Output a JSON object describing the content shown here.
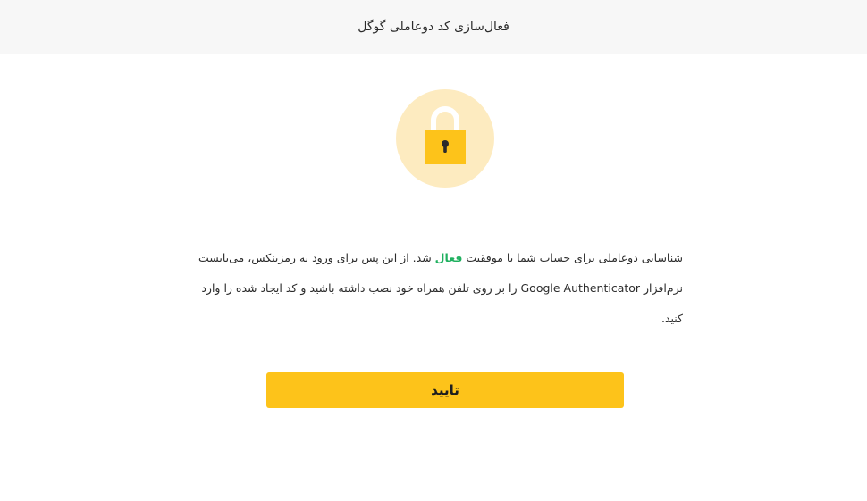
{
  "header": {
    "title": "فعال‌سازی کد دوعاملی گوگل"
  },
  "lock": {
    "icon": "padlock-icon",
    "circle_color": "#fdebc0",
    "body_color": "#fdc31a",
    "shackle_color": "#ffffff"
  },
  "message": {
    "part1": "شناسایی دوعاملی برای حساب شما با موفقیت ",
    "highlight": "فعال",
    "part2": " شد. از این پس برای ورود به رمزینکس، می‌بایست نرم‌افزار Google Authenticator را بر روی تلفن همراه خود نصب داشته باشید و کد ایجاد شده را وارد کنید.",
    "highlight_color": "#1fb05f"
  },
  "confirm_button": {
    "label": "تایید",
    "color": "#fdc31a"
  }
}
